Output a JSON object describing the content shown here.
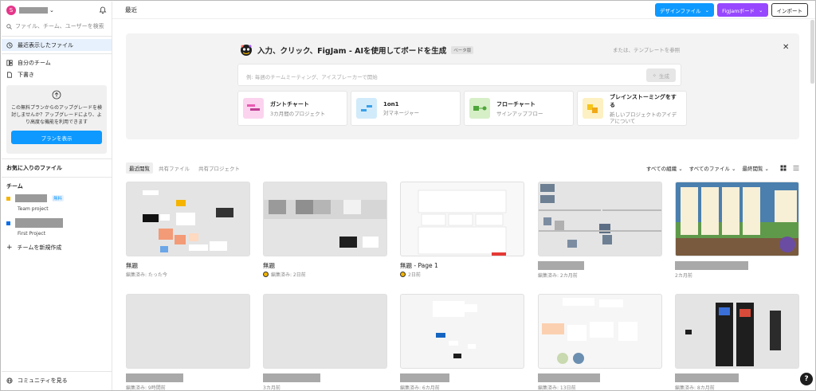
{
  "sidebar": {
    "avatar_letter": "S",
    "search_placeholder": "ファイル、チーム、ユーザーを検索",
    "nav": [
      {
        "label": "最近表示したファイル"
      },
      {
        "label": "自分のチーム"
      },
      {
        "label": "下書き"
      }
    ],
    "upgrade_text": "この無料プランからのアップグレードを検討しませんか？アップグレードにより、より高度な機能を利用できます",
    "upgrade_button": "プランを表示",
    "favorites_label": "お気に入りのファイル",
    "teams_label": "チーム",
    "team1_badge": "無料",
    "team1_project": "Team project",
    "team2_project": "First Project",
    "new_team": "チームを新規作成",
    "community": "コミュニティを見る"
  },
  "topbar": {
    "title": "最近",
    "design_file": "デザインファイル",
    "figjam_board": "FigJamボード",
    "import": "インポート"
  },
  "ai": {
    "title": "入力、クリック、FigJam - AIを使用してボードを生成",
    "beta": "ベータ版",
    "template_link": "または、テンプレートを参照",
    "placeholder": "例: 毎週のチームミーティング、アイスブレーカーで開始",
    "generate": "生成",
    "cards": [
      {
        "title": "ガントチャート",
        "sub": "3カ月間のプロジェクト"
      },
      {
        "title": "1on1",
        "sub": "対マネージャー"
      },
      {
        "title": "フローチャート",
        "sub": "サインアップフロー"
      },
      {
        "title": "ブレインストーミングをする",
        "sub": "新しいプロジェクトのアイデアについて"
      }
    ]
  },
  "filters": {
    "tabs": [
      "最近閲覧",
      "共有ファイル",
      "共有プロジェクト"
    ],
    "org": "すべての組織",
    "files": "すべてのファイル",
    "sort": "最終閲覧"
  },
  "files": [
    {
      "name": "無題",
      "meta": "編集済み: たった今"
    },
    {
      "name": "無題",
      "meta": "編集済み: 2日前"
    },
    {
      "name": "無題 - Page 1",
      "meta": "2日前"
    },
    {
      "name": "",
      "meta": "編集済み: 2カ月前"
    },
    {
      "name": "",
      "meta": "2カ月前"
    },
    {
      "name": "",
      "meta": "編集済み: 9時間前"
    },
    {
      "name": "",
      "meta": "3カ月前"
    },
    {
      "name": "",
      "meta": "編集済み: 6カ月前"
    },
    {
      "name": "",
      "meta": "編集済み: 13日前"
    },
    {
      "name": "",
      "meta": "編集済み: 8カ月前"
    }
  ],
  "help": "?"
}
